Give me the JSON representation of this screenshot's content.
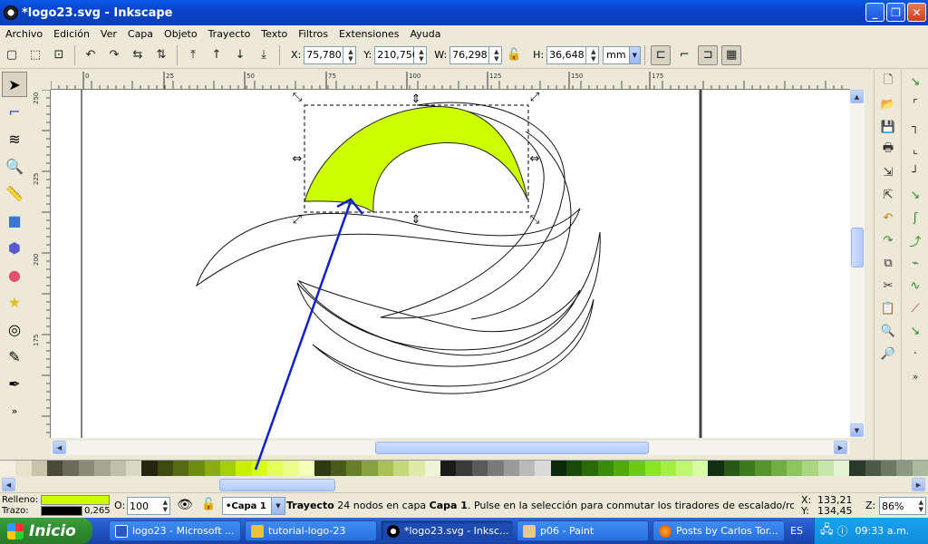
{
  "window": {
    "title": "*logo23.svg - Inkscape",
    "min": "_",
    "max": "❐",
    "close": "✕"
  },
  "menu": [
    "Archivo",
    "Edición",
    "Ver",
    "Capa",
    "Objeto",
    "Trayecto",
    "Texto",
    "Filtros",
    "Extensiones",
    "Ayuda"
  ],
  "toolbar": {
    "x_label": "X:",
    "x": "75,780",
    "y_label": "Y:",
    "y": "210,756",
    "w_label": "W:",
    "w": "76,298",
    "h_label": "H:",
    "h": "36,648",
    "unit": "mm"
  },
  "ruler": {
    "h_ticks": [
      "0",
      "25",
      "50",
      "75",
      "100",
      "125",
      "150",
      "175"
    ],
    "v_ticks": [
      "250",
      "225",
      "200",
      "175"
    ]
  },
  "status": {
    "fill_label": "Relleno:",
    "stroke_label": "Trazo:",
    "fill_color": "#ccff00",
    "stroke_color": "#000000",
    "stroke_width": "0,265",
    "opacity_label": "O:",
    "opacity": "100",
    "layer": "•Capa 1",
    "message_bold": "Trayecto",
    "message_mid": " 24 nodos en capa ",
    "message_layer": "Capa 1",
    "message_rest": ". Pulse en la selección para conmutar los tiradores de escalado/rotación.",
    "cx_label": "X:",
    "cx": "133,21",
    "cy_label": "Y:",
    "cy": "134,45",
    "zoom_label": "Z:",
    "zoom": "86%"
  },
  "palette": [
    "#f2efe0",
    "#e6e2cc",
    "#c8c4aa",
    "#4a4a3a",
    "#6a6a58",
    "#8a8a76",
    "#a6a690",
    "#c0c0aa",
    "#d8d8c4",
    "#262610",
    "#3e4a10",
    "#556a12",
    "#6e8c10",
    "#88ad10",
    "#a4cf0c",
    "#c8f000",
    "#d8ff1a",
    "#e4ff55",
    "#ecff8a",
    "#f4ffbb",
    "#2e3a10",
    "#4a5a1a",
    "#66802a",
    "#86a23c",
    "#a8c054",
    "#c6d87a",
    "#e0eaa8",
    "#f0f4d8",
    "#1a1a1a",
    "#3a3a3a",
    "#5a5a5a",
    "#7a7a7a",
    "#9a9a9a",
    "#bababa",
    "#dadada",
    "#0a2a0a",
    "#1a4a0a",
    "#2a6a0a",
    "#3c8a0a",
    "#52aa0a",
    "#6cca10",
    "#8ae620",
    "#a4f040",
    "#bef870",
    "#d8fca4",
    "#103010",
    "#265a16",
    "#3c7a20",
    "#56942e",
    "#70ae44",
    "#8cc45e",
    "#aad682",
    "#c8e6aa",
    "#e4f4d2",
    "#2a3a2a",
    "#4a5a46",
    "#6a7a62",
    "#8a9a80",
    "#aabaa0"
  ],
  "taskbar": {
    "start": "Inicio",
    "tasks": [
      "logo23 - Microsoft ...",
      "tutorial-logo-23",
      "*logo23.svg - Inksc...",
      "p06 - Paint",
      "Posts by Carlos Tor..."
    ],
    "lang": "ES",
    "clock": "09:33 a.m."
  },
  "colors": {
    "shape_fill": "#ccff00",
    "arrow": "#1020c8"
  }
}
